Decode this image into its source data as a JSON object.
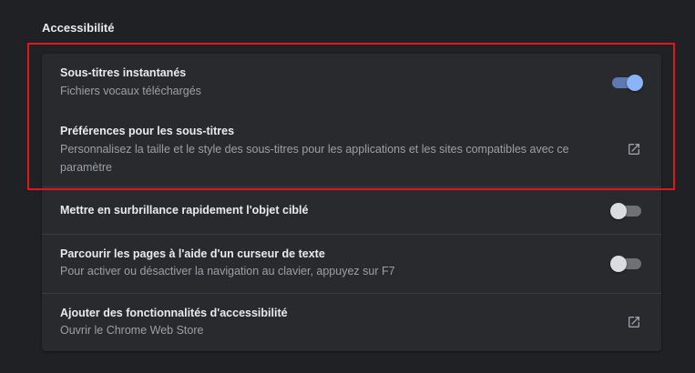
{
  "section": {
    "title": "Accessibilité"
  },
  "rows": [
    {
      "title": "Sous-titres instantanés",
      "subtitle": "Fichiers vocaux téléchargés",
      "control": "toggle",
      "state": "on"
    },
    {
      "title": "Préférences pour les sous-titres",
      "subtitle": "Personnalisez la taille et le style des sous-titres pour les applications et les sites compatibles avec ce paramètre",
      "control": "external-link-icon"
    },
    {
      "title": "Mettre en surbrillance rapidement l'objet ciblé",
      "subtitle": "",
      "control": "toggle",
      "state": "off"
    },
    {
      "title": "Parcourir les pages à l'aide d'un curseur de texte",
      "subtitle": "Pour activer ou désactiver la navigation au clavier, appuyez sur F7",
      "control": "toggle",
      "state": "off"
    },
    {
      "title": "Ajouter des fonctionnalités d'accessibilité",
      "subtitle": "Ouvrir le Chrome Web Store",
      "control": "external-link-icon"
    }
  ],
  "colors": {
    "background": "#202124",
    "card": "#292a2d",
    "toggle_on": "#8ab4f8",
    "highlight_border": "#e0161d"
  }
}
